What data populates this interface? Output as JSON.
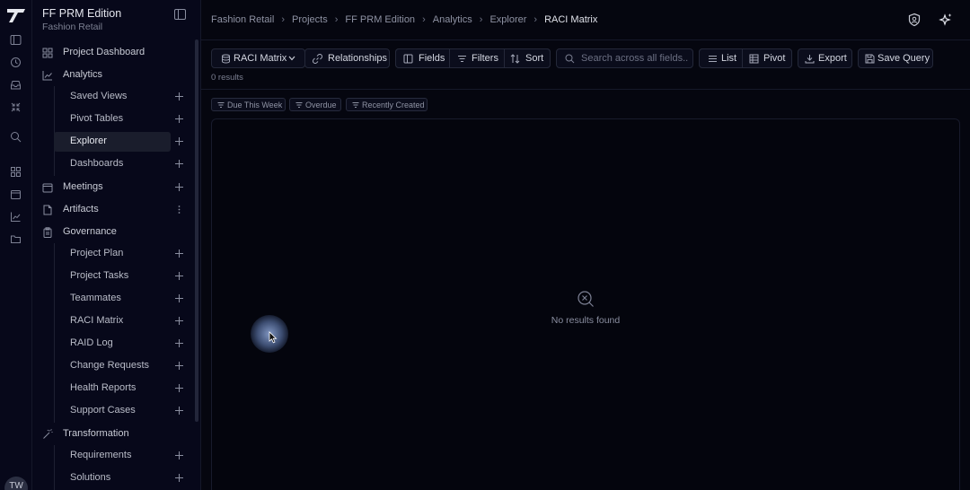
{
  "app": {
    "title": "FF PRM Edition",
    "subtitle": "Fashion Retail",
    "avatar_initials": "TW",
    "accent": "#5a7fd0"
  },
  "breadcrumb": [
    "Fashion Retail",
    "Projects",
    "FF PRM Edition",
    "Analytics",
    "Explorer",
    "RACI Matrix"
  ],
  "sidebar": {
    "items": [
      {
        "label": "Project Dashboard",
        "icon": "grid-icon"
      },
      {
        "label": "Analytics",
        "icon": "chart-icon"
      },
      {
        "label": "Meetings",
        "icon": "calendar-icon"
      },
      {
        "label": "Artifacts",
        "icon": "file-icon"
      },
      {
        "label": "Governance",
        "icon": "clipboard-icon"
      },
      {
        "label": "Transformation",
        "icon": "wand-icon"
      }
    ],
    "analytics_children": [
      {
        "label": "Saved Views"
      },
      {
        "label": "Pivot Tables"
      },
      {
        "label": "Explorer"
      },
      {
        "label": "Dashboards"
      }
    ],
    "governance_children": [
      {
        "label": "Project Plan"
      },
      {
        "label": "Project Tasks"
      },
      {
        "label": "Teammates"
      },
      {
        "label": "RACI Matrix"
      },
      {
        "label": "RAID Log"
      },
      {
        "label": "Change Requests"
      },
      {
        "label": "Health Reports"
      },
      {
        "label": "Support Cases"
      }
    ],
    "transformation_children": [
      {
        "label": "Requirements"
      },
      {
        "label": "Solutions"
      }
    ]
  },
  "toolbar": {
    "entity_label": "RACI Matrix",
    "relationships_label": "Relationships",
    "fields_label": "Fields",
    "filters_label": "Filters",
    "sort_label": "Sort",
    "search_placeholder": "Search across all fields..",
    "list_label": "List",
    "pivot_label": "Pivot",
    "export_label": "Export",
    "save_query_label": "Save Query"
  },
  "results_count": "0 results",
  "quick_filters": [
    "Due This Week",
    "Overdue",
    "Recently Created"
  ],
  "empty_state": "No results found"
}
